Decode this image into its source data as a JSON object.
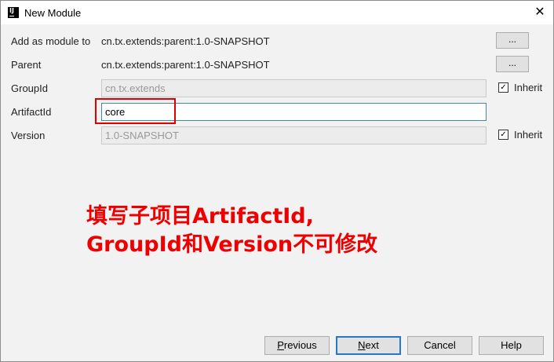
{
  "window": {
    "title": "New Module",
    "app_icon_text": "IJ",
    "close_glyph": "✕"
  },
  "form": {
    "add_as_module": {
      "label": "Add as module to",
      "value": "cn.tx.extends:parent:1.0-SNAPSHOT",
      "browse_label": "..."
    },
    "parent": {
      "label": "Parent",
      "value": "cn.tx.extends:parent:1.0-SNAPSHOT",
      "browse_label": "..."
    },
    "group_id": {
      "label": "GroupId",
      "value": "cn.tx.extends",
      "inherit_label": "Inherit",
      "inherit_checked": true
    },
    "artifact_id": {
      "label": "ArtifactId",
      "value": "core"
    },
    "version": {
      "label": "Version",
      "value": "1.0-SNAPSHOT",
      "inherit_label": "Inherit",
      "inherit_checked": true
    }
  },
  "annotation": {
    "line1": "填写子项目ArtifactId,",
    "line2": "GroupId和Version不可修改",
    "color": "#ee0000"
  },
  "buttons": {
    "previous": {
      "first": "P",
      "rest": "revious"
    },
    "next": {
      "first": "N",
      "rest": "ext"
    },
    "cancel": "Cancel",
    "help": "Help"
  },
  "icons": {
    "checkbox_checked": "check-icon"
  }
}
